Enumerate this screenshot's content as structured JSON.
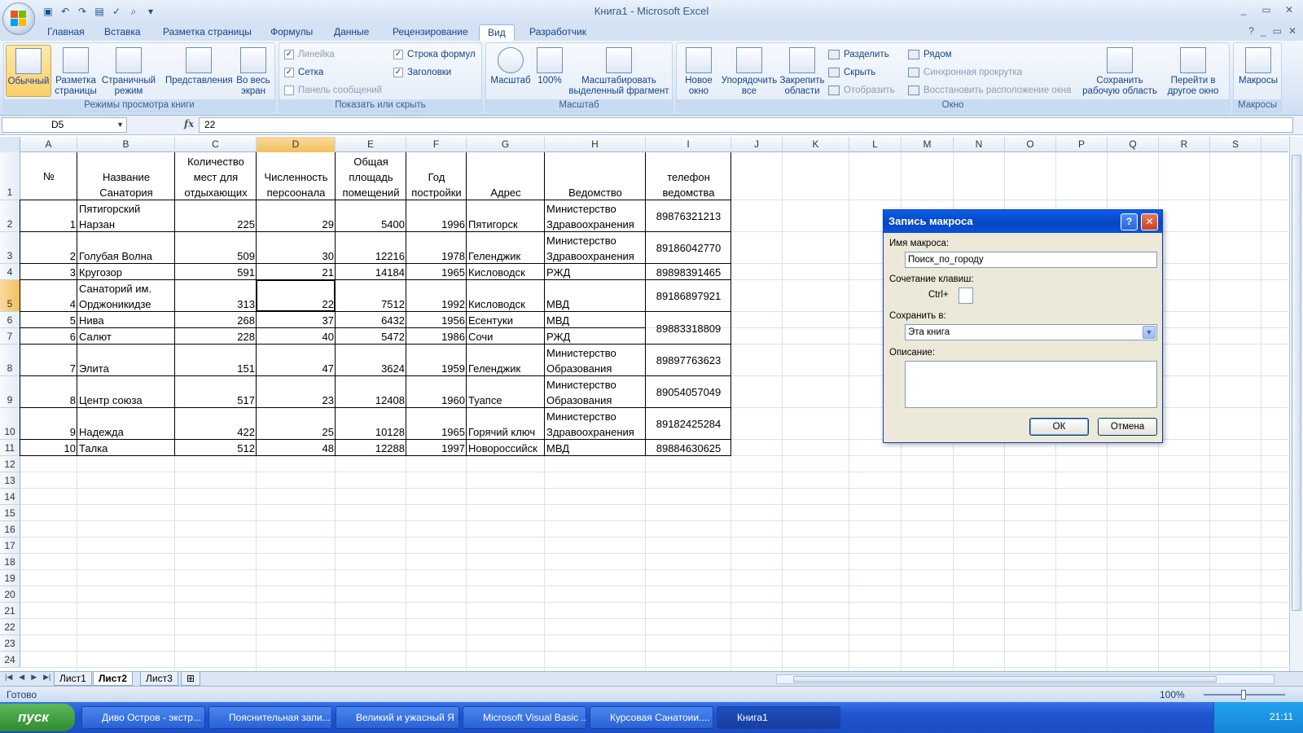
{
  "window": {
    "title": "Книга1 - Microsoft Excel",
    "controls": [
      "_",
      "▭",
      "✕"
    ]
  },
  "ribbon_tabs": [
    "Главная",
    "Вставка",
    "Разметка страницы",
    "Формулы",
    "Данные",
    "Рецензирование",
    "Вид",
    "Разработчик"
  ],
  "active_tab": "Вид",
  "ribbon": {
    "group1": {
      "label": "Режимы просмотра книги",
      "buttons": [
        "Обычный",
        "Разметка страницы",
        "Страничный режим",
        "Представления",
        "Во весь экран"
      ]
    },
    "group2": {
      "label": "Показать или скрыть",
      "items": [
        {
          "label": "Линейка",
          "checked": "✓",
          "disabled": true
        },
        {
          "label": "Строка формул",
          "checked": "✓",
          "disabled": false
        },
        {
          "label": "Сетка",
          "checked": "✓",
          "disabled": false
        },
        {
          "label": "Заголовки",
          "checked": "✓",
          "disabled": false
        },
        {
          "label": "Панель сообщений",
          "checked": "",
          "disabled": true
        }
      ]
    },
    "group3": {
      "label": "Масштаб",
      "buttons": [
        "Масштаб",
        "100%",
        "Масштабировать выделенный фрагмент"
      ]
    },
    "group4": {
      "label": "Окно",
      "buttons": [
        "Новое окно",
        "Упорядочить все",
        "Закрепить области"
      ],
      "small": [
        "Разделить",
        "Скрыть",
        "Отобразить",
        "Рядом",
        "Синхронная прокрутка",
        "Восстановить расположение окна"
      ],
      "buttons2": [
        "Сохранить рабочую область",
        "Перейти в другое окно"
      ]
    },
    "group5": {
      "label": "Макросы",
      "buttons": [
        "Макросы"
      ]
    }
  },
  "formula_bar": {
    "name_box": "D5",
    "fx": "fx",
    "value": "22"
  },
  "columns": [
    "A",
    "B",
    "C",
    "D",
    "E",
    "F",
    "G",
    "H",
    "I",
    "J",
    "K",
    "L",
    "M",
    "N",
    "O",
    "P",
    "Q",
    "R",
    "S"
  ],
  "rows": [
    "1",
    "2",
    "3",
    "4",
    "5",
    "6",
    "7",
    "8",
    "9",
    "10",
    "11",
    "12",
    "13",
    "14",
    "15",
    "16",
    "17",
    "18",
    "19",
    "20",
    "21",
    "22",
    "23",
    "24"
  ],
  "headers": {
    "a": "№",
    "b": [
      "Название",
      "Санатория"
    ],
    "c": [
      "Количество",
      "мест для",
      "отдыхающих"
    ],
    "d": [
      "Численность",
      "персоонала"
    ],
    "e": [
      "Общая",
      "площадь",
      "помещений"
    ],
    "f": [
      "Год",
      "постройки"
    ],
    "g": "Адрес",
    "h": "Ведомство",
    "i": [
      "телефон",
      "ведомства"
    ]
  },
  "table_rows": [
    {
      "num": "1",
      "name": [
        "Пятигорский",
        "Нарзан"
      ],
      "places": "225",
      "staff": "29",
      "area": "5400",
      "year": "1996",
      "address": "Пятигорск",
      "dept": [
        "Министерство",
        "Здравоохранения"
      ],
      "phone": "89876321213"
    },
    {
      "num": "2",
      "name": [
        "Голубая Волна"
      ],
      "places": "509",
      "staff": "30",
      "area": "12216",
      "year": "1978",
      "address": "Геленджик",
      "dept": [
        "Министерство",
        "Здравоохранения"
      ],
      "phone": "89186042770"
    },
    {
      "num": "3",
      "name": [
        "Кругозор"
      ],
      "places": "591",
      "staff": "21",
      "area": "14184",
      "year": "1965",
      "address": "Кисловодск",
      "dept": [
        "РЖД"
      ],
      "phone": "89898391465"
    },
    {
      "num": "4",
      "name": [
        "Санаторий им.",
        "Орджоникидзе"
      ],
      "places": "313",
      "staff": "22",
      "area": "7512",
      "year": "1992",
      "address": "Кисловодск",
      "dept": [
        "МВД"
      ],
      "phone": "89186897921"
    },
    {
      "num": "5",
      "name": [
        "Нива"
      ],
      "places": "268",
      "staff": "37",
      "area": "6432",
      "year": "1956",
      "address": "Есентуки",
      "dept": [
        "МВД"
      ],
      "phone": ""
    },
    {
      "num": "6",
      "name": [
        "Салют"
      ],
      "places": "228",
      "staff": "40",
      "area": "5472",
      "year": "1986",
      "address": "Сочи",
      "dept": [
        "РЖД"
      ],
      "phone": "89883318809"
    },
    {
      "num": "7",
      "name": [
        "Элита"
      ],
      "places": "151",
      "staff": "47",
      "area": "3624",
      "year": "1959",
      "address": "Геленджик",
      "dept": [
        "Министерство",
        "Образования"
      ],
      "phone": "89897763623"
    },
    {
      "num": "8",
      "name": [
        "Центр союза"
      ],
      "places": "517",
      "staff": "23",
      "area": "12408",
      "year": "1960",
      "address": "Туапсе",
      "dept": [
        "Министерство",
        "Образования"
      ],
      "phone": "89054057049"
    },
    {
      "num": "9",
      "name": [
        "Надежда"
      ],
      "places": "422",
      "staff": "25",
      "area": "10128",
      "year": "1965",
      "address": "Горячий ключ",
      "dept": [
        "Министерство",
        "Здравоохранения"
      ],
      "phone": "89182425284"
    },
    {
      "num": "10",
      "name": [
        "Талка"
      ],
      "places": "512",
      "staff": "48",
      "area": "12288",
      "year": "1997",
      "address": "Новороссийск",
      "dept": [
        "МВД"
      ],
      "phone": "89884630625"
    }
  ],
  "sheet_tabs": [
    "Лист1",
    "Лист2",
    "Лист3"
  ],
  "active_sheet": "Лист2",
  "status": {
    "text": "Готово",
    "zoom": "100%",
    "zoom_level_percent": 100
  },
  "dialog": {
    "title": "Запись макроса",
    "help": "?",
    "close": "✕",
    "name_label": "Имя макроса:",
    "name_value": "Поиск_по_городу",
    "shortcut_label": "Сочетание клавиш:",
    "ctrl_label": "Ctrl+",
    "store_label": "Сохранить в:",
    "store_value": "Эта книга",
    "desc_label": "Описание:",
    "ok": "ОК",
    "cancel": "Отмена"
  },
  "taskbar": {
    "start": "пуск",
    "items": [
      "Диво Остров - экстр...",
      "Пояснительная запи...",
      "Великий и ужасный Я",
      "Microsoft Visual Basic ...",
      "Курсовая Санатоии....",
      "Книга1"
    ],
    "time": "21:11"
  },
  "colors": {
    "ribbon_bg": "#dbe7f6",
    "accent": "#15428b",
    "selected_header": "#f1c15e",
    "dialog_title": "#0846c2"
  }
}
